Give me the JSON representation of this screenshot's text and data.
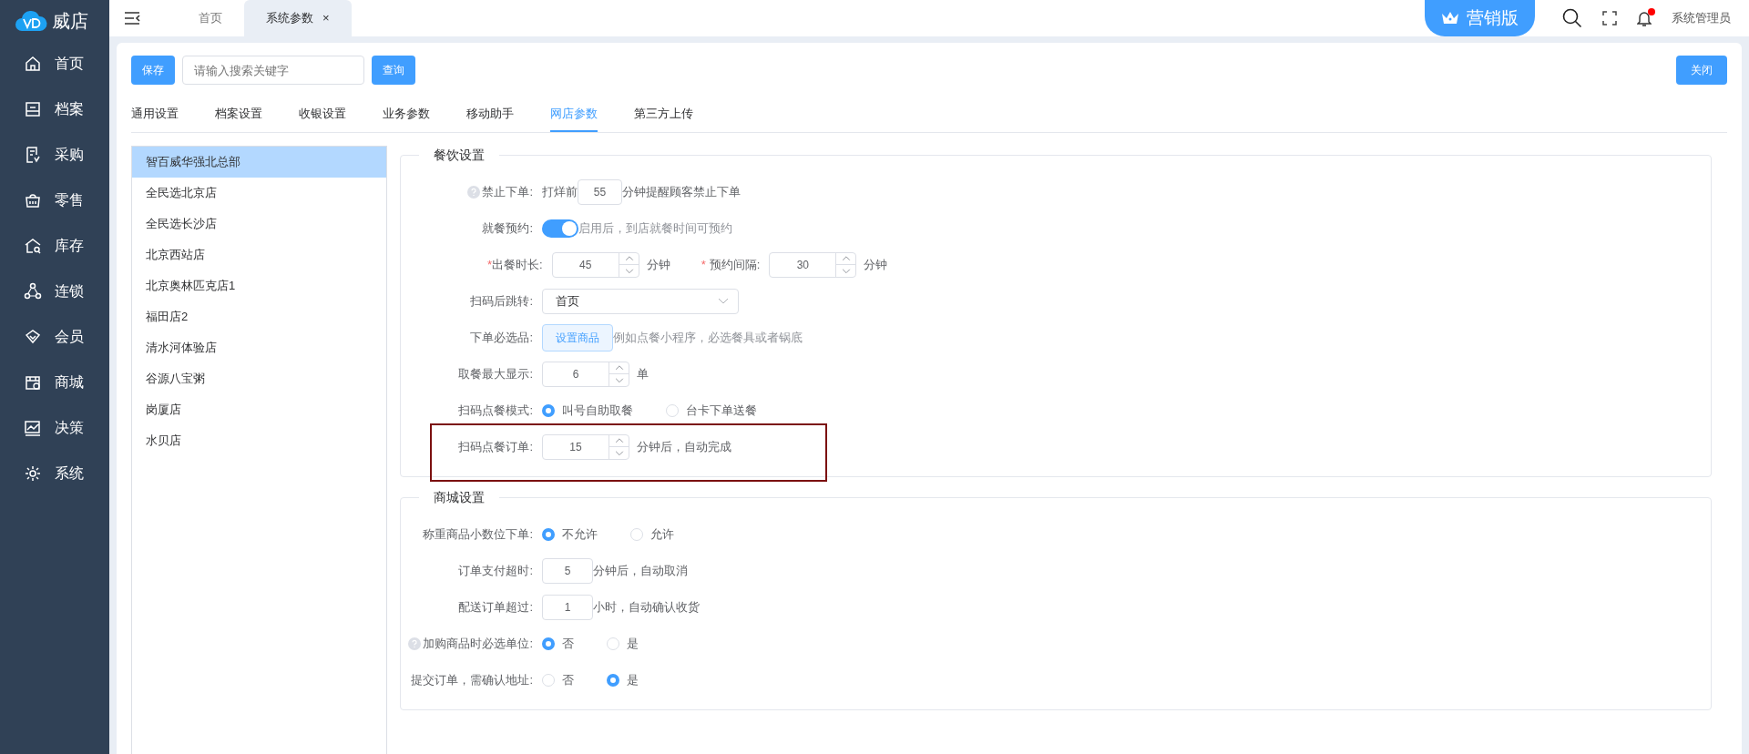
{
  "logo": {
    "text": "威店"
  },
  "header": {
    "tabs": [
      {
        "label": "首页",
        "selected": false
      },
      {
        "label": "系统参数",
        "selected": true,
        "close": "×"
      }
    ],
    "edition": "营销版",
    "has_notification": true,
    "user": "系统管理员"
  },
  "sidebar": {
    "items": [
      {
        "label": "首页"
      },
      {
        "label": "档案"
      },
      {
        "label": "采购"
      },
      {
        "label": "零售"
      },
      {
        "label": "库存"
      },
      {
        "label": "连锁"
      },
      {
        "label": "会员"
      },
      {
        "label": "商城"
      },
      {
        "label": "决策"
      },
      {
        "label": "系统"
      }
    ]
  },
  "toolbar": {
    "save": "保存",
    "search": {
      "placeholder": "请输入搜索关键字"
    },
    "query": "查询",
    "close": "关闭"
  },
  "settings_tabs": [
    {
      "label": "通用设置",
      "selected": false
    },
    {
      "label": "档案设置",
      "selected": false
    },
    {
      "label": "收银设置",
      "selected": false
    },
    {
      "label": "业务参数",
      "selected": false
    },
    {
      "label": "移动助手",
      "selected": false
    },
    {
      "label": "网店参数",
      "selected": true
    },
    {
      "label": "第三方上传",
      "selected": false
    }
  ],
  "stores": [
    {
      "label": "智百威华强北总部",
      "selected": true
    },
    {
      "label": "全民选北京店",
      "selected": false
    },
    {
      "label": "全民选长沙店",
      "selected": false
    },
    {
      "label": "北京西站店",
      "selected": false
    },
    {
      "label": "北京奥林匹克店1",
      "selected": false
    },
    {
      "label": "福田店2",
      "selected": false
    },
    {
      "label": "清水河体验店",
      "selected": false
    },
    {
      "label": "谷源八宝粥",
      "selected": false
    },
    {
      "label": "岗厦店",
      "selected": false
    },
    {
      "label": "水贝店",
      "selected": false
    }
  ],
  "sections": [
    {
      "title": "餐饮设置",
      "rows": [
        {
          "kind": "input",
          "label": "禁止下单:",
          "help": true,
          "prefix": "打烊前",
          "value": "55",
          "suffix": "分钟提醒顾客禁止下单"
        },
        {
          "kind": "switch",
          "label": "就餐预约:",
          "on": true,
          "hint": "启用后，到店就餐时间可预约"
        },
        {
          "kind": "pair",
          "items": [
            {
              "label": "出餐时长:",
              "required": "*",
              "value": "45",
              "suffix": "分钟"
            },
            {
              "label": "预约间隔:",
              "required": "*",
              "value": "30",
              "suffix": "分钟"
            }
          ]
        },
        {
          "kind": "select",
          "label": "扫码后跳转:",
          "value": "首页"
        },
        {
          "kind": "button",
          "label": "下单必选品:",
          "button": "设置商品",
          "hint": "例如点餐小程序，必选餐具或者锅底"
        },
        {
          "kind": "spinner",
          "label": "取餐最大显示:",
          "value": "6",
          "suffix": "单"
        },
        {
          "kind": "radio",
          "label": "扫码点餐模式:",
          "options": [
            {
              "label": "叫号自助取餐",
              "selected": true
            },
            {
              "label": "台卡下单送餐",
              "selected": false
            }
          ]
        },
        {
          "kind": "spinner",
          "label": "扫码点餐订单:",
          "value": "15",
          "suffix": "分钟后，自动完成",
          "highlighted": true
        }
      ]
    },
    {
      "title": "商城设置",
      "rows": [
        {
          "kind": "radio",
          "label": "称重商品小数位下单:",
          "options": [
            {
              "label": "不允许",
              "selected": true
            },
            {
              "label": "允许",
              "selected": false
            }
          ]
        },
        {
          "kind": "input",
          "label": "订单支付超时:",
          "value": "5",
          "suffix": "分钟后，自动取消"
        },
        {
          "kind": "input",
          "label": "配送订单超过:",
          "value": "1",
          "suffix": "小时，自动确认收货"
        },
        {
          "kind": "radio",
          "label": "加购商品时必选单位:",
          "help": true,
          "options": [
            {
              "label": "否",
              "selected": true
            },
            {
              "label": "是",
              "selected": false
            }
          ]
        },
        {
          "kind": "radio",
          "label": "提交订单，需确认地址:",
          "options": [
            {
              "label": "否",
              "selected": false
            },
            {
              "label": "是",
              "selected": true
            }
          ]
        }
      ]
    }
  ]
}
